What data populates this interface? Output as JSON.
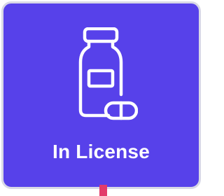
{
  "card": {
    "label": "In License",
    "icon": "pill-bottle-capsule-icon",
    "background_color": "#5741ea",
    "icon_color": "#ffffff",
    "marker_color": "#e23b6a"
  }
}
